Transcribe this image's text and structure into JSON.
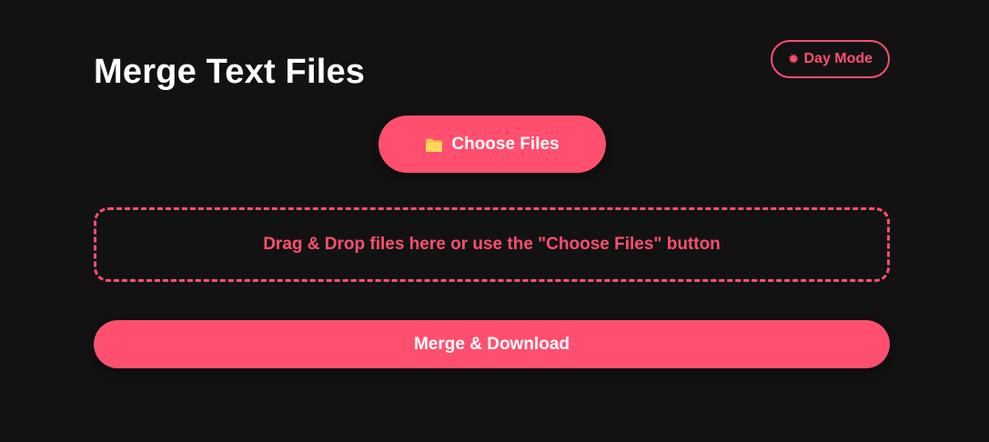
{
  "header": {
    "title": "Merge Text Files",
    "mode_toggle": {
      "icon": "sun-icon",
      "icon_glyph": "✹",
      "label": "Day Mode"
    }
  },
  "upload": {
    "choose_button": {
      "icon": "folder-icon",
      "label": "Choose Files"
    },
    "drop_zone_text": "Drag & Drop files here or use the \"Choose Files\" button"
  },
  "actions": {
    "merge_label": "Merge & Download"
  },
  "colors": {
    "background": "#121212",
    "accent": "#ff4f6f",
    "text": "#ffffff",
    "folder_icon": "#f7c34a"
  }
}
